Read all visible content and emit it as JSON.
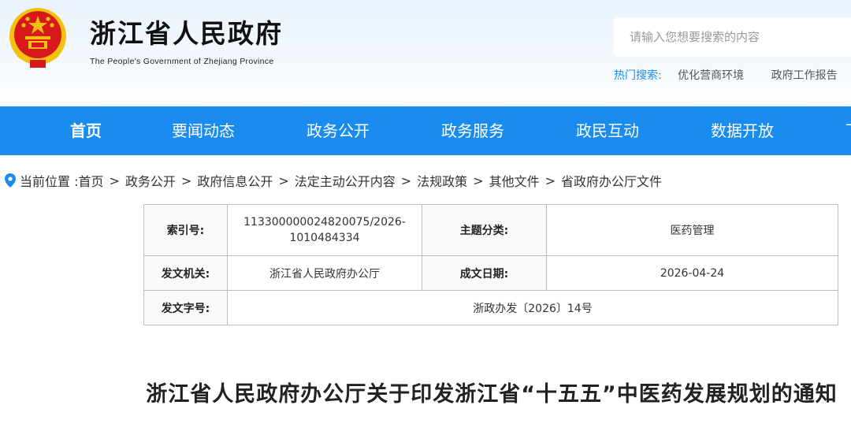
{
  "header": {
    "title": "浙江省人民政府",
    "subtitle": "The People's Government of Zhejiang Province",
    "emblem_icon": "national-emblem-icon"
  },
  "search": {
    "placeholder": "请输入您想要搜索的内容",
    "hot_label": "热门搜索:",
    "hot_items": [
      "优化营商环境",
      "政府工作报告"
    ]
  },
  "nav": {
    "items": [
      "首页",
      "要闻动态",
      "政务公开",
      "政务服务",
      "政民互动",
      "数据开放",
      "下"
    ],
    "active_index": 0
  },
  "breadcrumb": {
    "prefix": "当前位置 :",
    "items": [
      "首页",
      "政务公开",
      "政府信息公开",
      "法定主动公开内容",
      "法规政策",
      "其他文件",
      "省政府办公厅文件"
    ],
    "separator": ">"
  },
  "info": {
    "index_label": "索引号:",
    "index_value": "113300000024820075/2026-1010484334",
    "topic_label": "主题分类:",
    "topic_value": "医药管理",
    "issuer_label": "发文机关:",
    "issuer_value": "浙江省人民政府办公厅",
    "date_label": "成文日期:",
    "date_value": "2026-04-24",
    "docno_label": "发文字号:",
    "docno_value": "浙政办发〔2026〕14号"
  },
  "article": {
    "title": "浙江省人民政府办公厅关于印发浙江省“十五五”中医药发展规划的通知"
  },
  "colors": {
    "nav_bg": "#1a8bef",
    "hot_label": "#1a8bef",
    "emblem_red": "#d7191c",
    "emblem_gold": "#f3c10e"
  }
}
